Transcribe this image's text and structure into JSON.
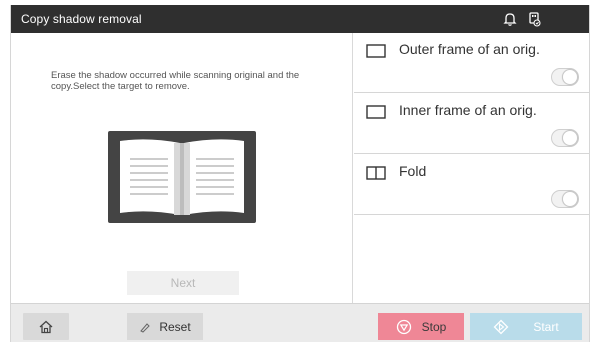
{
  "window": {
    "title": "Copy shadow removal",
    "icons": [
      "bell-icon",
      "usb-icon"
    ]
  },
  "left_panel": {
    "description": "Erase the shadow occurred while scanning original and the copy.Select the target to remove.",
    "preview_icon": "open-book-icon",
    "next_label": "Next"
  },
  "options": [
    {
      "label": "Outer frame of an orig.",
      "icon": "outer-frame-icon",
      "enabled": false
    },
    {
      "label": "Inner frame of an orig.",
      "icon": "inner-frame-icon",
      "enabled": false
    },
    {
      "label": "Fold",
      "icon": "fold-icon",
      "enabled": false
    }
  ],
  "bottom_bar": {
    "home_icon": "home-icon",
    "reset_label": "Reset",
    "stop_label": "Stop",
    "start_label": "Start"
  },
  "colors": {
    "titlebar": "#2f2f2f",
    "stop": "#ef8796",
    "start": "#b9dcea",
    "bottombar": "#ebebeb"
  }
}
